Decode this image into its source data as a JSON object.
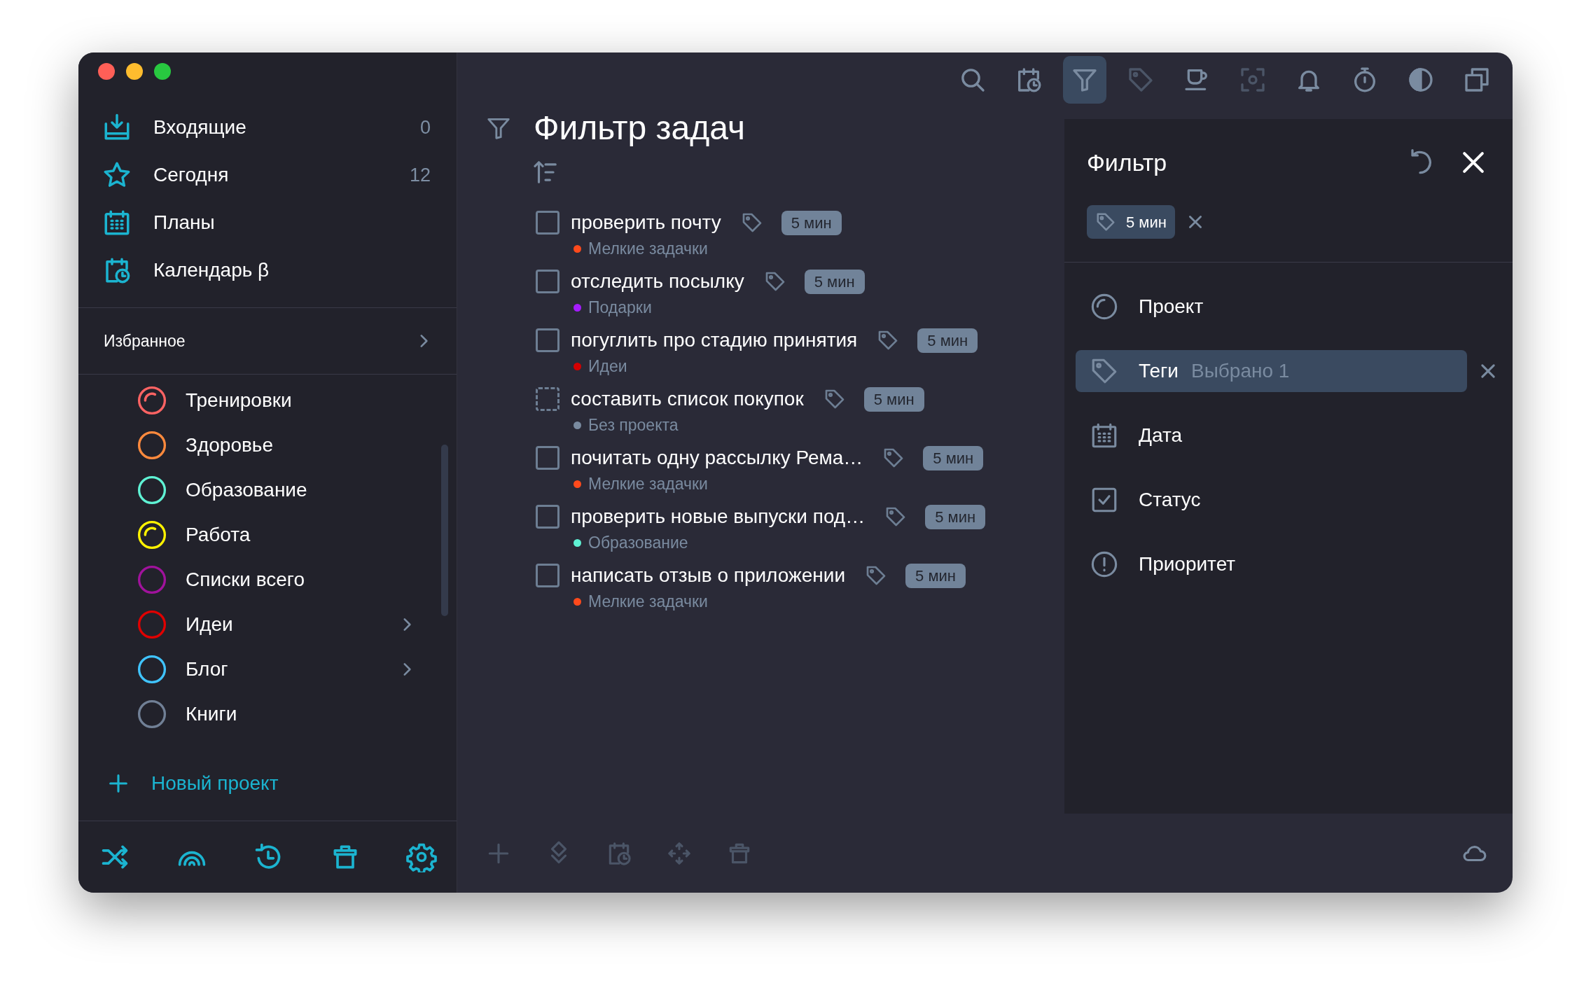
{
  "window": {
    "traffic_lights": [
      {
        "color": "#ff5f57"
      },
      {
        "color": "#febc2e"
      },
      {
        "color": "#28c840"
      }
    ]
  },
  "sidebar": {
    "nav": [
      {
        "kind": "inbox",
        "label": "Входящие",
        "count": "0"
      },
      {
        "kind": "today",
        "label": "Сегодня",
        "count": "12"
      },
      {
        "kind": "plans",
        "label": "Планы"
      },
      {
        "kind": "calendar",
        "label": "Календарь β"
      }
    ],
    "favorites": {
      "label": "Избранное"
    },
    "projects": [
      {
        "name": "Тренировки",
        "color": "#ff6363",
        "kind": "started",
        "expandable": false
      },
      {
        "name": "Здоровье",
        "color": "#ff8a3d",
        "kind": "plain",
        "expandable": false
      },
      {
        "name": "Образование",
        "color": "#5ff2d4",
        "kind": "plain",
        "expandable": false
      },
      {
        "name": "Работа",
        "color": "#fff200",
        "kind": "started",
        "expandable": false
      },
      {
        "name": "Списки всего",
        "color": "#a0129c",
        "kind": "plain",
        "expandable": false
      },
      {
        "name": "Идеи",
        "color": "#e00000",
        "kind": "plain",
        "expandable": true
      },
      {
        "name": "Блог",
        "color": "#40c4ff",
        "kind": "plain",
        "expandable": true
      },
      {
        "name": "Книги",
        "color": "#718096",
        "kind": "plain",
        "expandable": false
      }
    ],
    "new_project": "Новый проект",
    "footer": [
      {
        "kind": "shuffle"
      },
      {
        "kind": "rainbow"
      },
      {
        "kind": "history"
      },
      {
        "kind": "trash"
      },
      {
        "kind": "settings"
      }
    ]
  },
  "toolbar": [
    {
      "kind": "search",
      "selected": false,
      "disabled": false
    },
    {
      "kind": "calendar",
      "selected": false,
      "disabled": false
    },
    {
      "kind": "filter",
      "selected": true,
      "disabled": false
    },
    {
      "kind": "tag",
      "selected": false,
      "disabled": true
    },
    {
      "kind": "cup",
      "selected": false,
      "disabled": false
    },
    {
      "kind": "focus",
      "selected": false,
      "disabled": true
    },
    {
      "kind": "bell",
      "selected": false,
      "disabled": false
    },
    {
      "kind": "timer",
      "selected": false,
      "disabled": false
    },
    {
      "kind": "contrast",
      "selected": false,
      "disabled": false
    },
    {
      "kind": "windows",
      "selected": false,
      "disabled": false
    }
  ],
  "task_list": {
    "title": "Фильтр задач",
    "tasks": [
      {
        "title": "проверить почту",
        "checked": false,
        "kind": "regular",
        "tag": "5 мин",
        "project": "Мелкие задачки",
        "color": "#ff4a1c"
      },
      {
        "title": "отследить посылку",
        "checked": false,
        "kind": "regular",
        "tag": "5 мин",
        "project": "Подарки",
        "color": "#a51cff"
      },
      {
        "title": "погуглить про стадию принятия",
        "checked": false,
        "kind": "regular",
        "tag": "5 мин",
        "project": "Идеи",
        "color": "#d40000"
      },
      {
        "title": "составить список покупок",
        "checked": false,
        "kind": "unassigned",
        "tag": "5 мин",
        "project": "Без проекта",
        "color": "#7a8ba0"
      },
      {
        "title": "почитать одну рассылку Рема…",
        "checked": false,
        "kind": "regular",
        "tag": "5 мин",
        "project": "Мелкие задачки",
        "color": "#ff4a1c"
      },
      {
        "title": "проверить новые выпуски под…",
        "checked": false,
        "kind": "regular",
        "tag": "5 мин",
        "project": "Образование",
        "color": "#5ff2d4"
      },
      {
        "title": "написать отзыв о приложении",
        "checked": false,
        "kind": "regular",
        "tag": "5 мин",
        "project": "Мелкие задачки",
        "color": "#ff4a1c"
      }
    ]
  },
  "bottom_toolbar": [
    {
      "kind": "plus",
      "disabled": true
    },
    {
      "kind": "layers",
      "disabled": true
    },
    {
      "kind": "calendar",
      "disabled": true
    },
    {
      "kind": "move",
      "disabled": true
    },
    {
      "kind": "trash",
      "disabled": true
    },
    {
      "kind": "cloud",
      "disabled": false
    }
  ],
  "filter_panel": {
    "title": "Фильтр",
    "chips": [
      {
        "label": "5 мин"
      }
    ],
    "criteria": [
      {
        "kind": "project",
        "label": "Проект",
        "selected": false
      },
      {
        "kind": "tags",
        "label": "Теги",
        "value": "Выбрано 1",
        "selected": true
      },
      {
        "kind": "date",
        "label": "Дата",
        "selected": false
      },
      {
        "kind": "status",
        "label": "Статус",
        "selected": false
      },
      {
        "kind": "priority",
        "label": "Приоритет",
        "selected": false
      }
    ]
  }
}
